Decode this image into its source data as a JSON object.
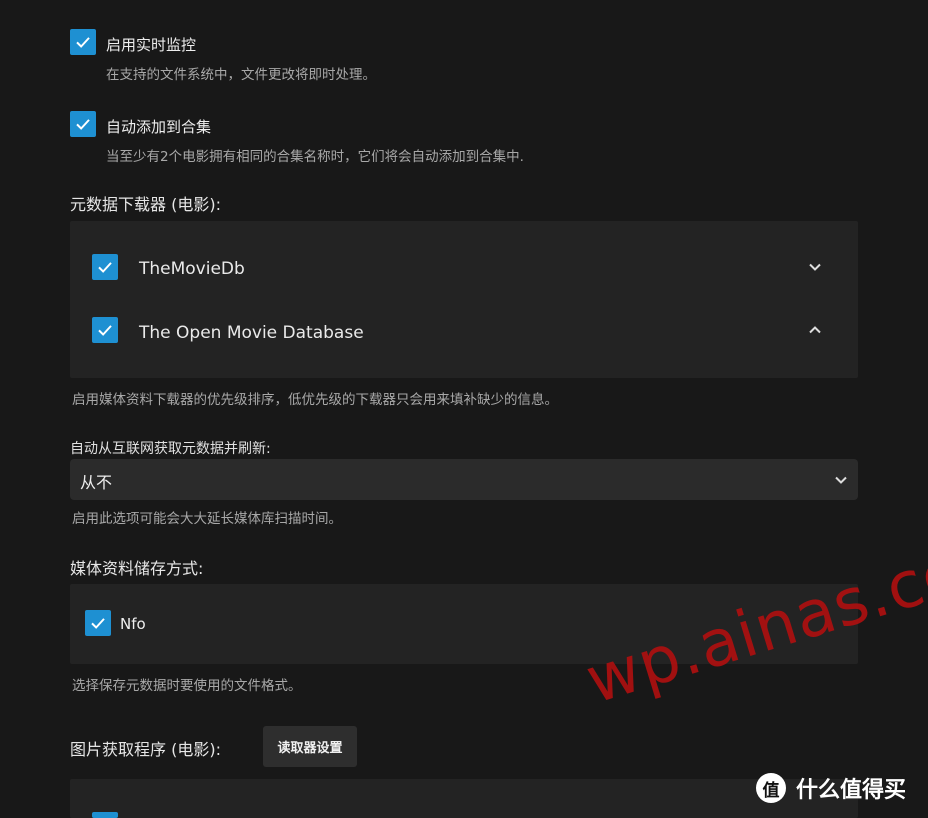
{
  "realtime": {
    "label": "启用实时监控",
    "desc": "在支持的文件系统中，文件更改将即时处理。",
    "checked": true
  },
  "collections": {
    "label": "自动添加到合集",
    "desc": "当至少有2个电影拥有相同的合集名称时，它们将会自动添加到合集中.",
    "checked": true
  },
  "metadata_downloaders": {
    "heading": "元数据下载器 (电影):",
    "items": [
      {
        "label": "TheMovieDb",
        "checked": true,
        "chevron": "chevron-down-icon"
      },
      {
        "label": "The Open Movie Database",
        "checked": true,
        "chevron": "chevron-up-icon"
      }
    ],
    "desc": "启用媒体资料下载器的优先级排序，低优先级的下载器只会用来填补缺少的信息。"
  },
  "refresh": {
    "label": "自动从互联网获取元数据并刷新:",
    "selected": "从不",
    "desc": "启用此选项可能会大大延长媒体库扫描时间。"
  },
  "savers": {
    "heading": "媒体资料储存方式:",
    "items": [
      {
        "label": "Nfo",
        "checked": true
      }
    ],
    "desc": "选择保存元数据时要使用的文件格式。"
  },
  "image_fetchers": {
    "heading": "图片获取程序 (电影):",
    "button": "读取器设置"
  },
  "watermark": {
    "text": "wp.ainas.cc",
    "brand_glyph": "值",
    "brand_text": "什么值得买"
  },
  "colors": {
    "accent": "#1e90d2",
    "background": "#181818",
    "panel": "#232323",
    "watermark": "#b01010"
  }
}
